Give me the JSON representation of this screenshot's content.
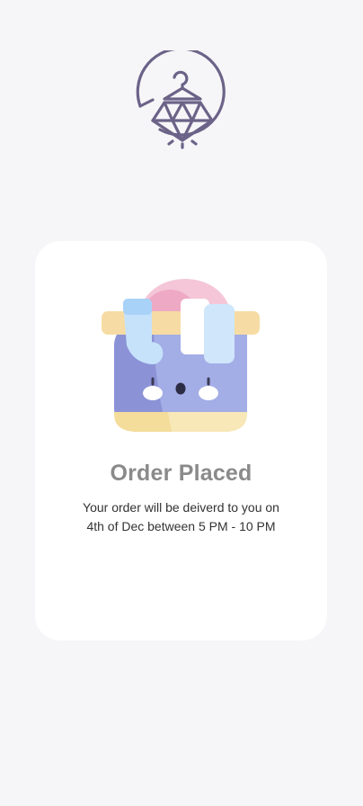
{
  "brand": {
    "logo_icon": "hanger-diamond-logo-icon",
    "accent": "#6c6388"
  },
  "confirmation": {
    "illustration_icon": "laundry-basket-icon",
    "title": "Order Placed",
    "message_line1": "Your order will be deiverd to you on",
    "message_line2": "4th of Dec between 5 PM - 10 PM"
  },
  "colors": {
    "background": "#f6f6f8",
    "card": "#ffffff",
    "title": "#8a8a8a",
    "body_text": "#333333"
  }
}
